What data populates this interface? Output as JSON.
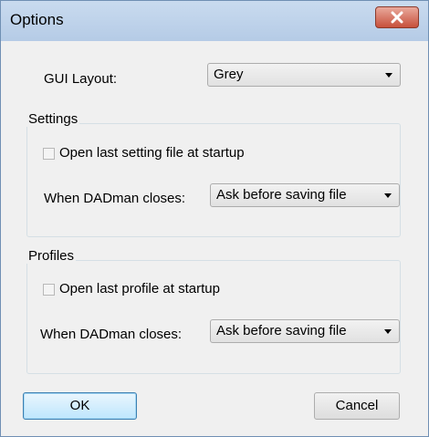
{
  "window": {
    "title": "Options"
  },
  "gui_layout": {
    "label": "GUI Layout:",
    "value": "Grey"
  },
  "settings": {
    "title": "Settings",
    "checkbox_label": "Open last setting file at startup",
    "checkbox_checked": false,
    "close_label": "When DADman closes:",
    "close_value": "Ask before saving file"
  },
  "profiles": {
    "title": "Profiles",
    "checkbox_label": "Open last profile at startup",
    "checkbox_checked": false,
    "close_label": "When DADman closes:",
    "close_value": "Ask before saving file"
  },
  "buttons": {
    "ok": "OK",
    "cancel": "Cancel"
  }
}
